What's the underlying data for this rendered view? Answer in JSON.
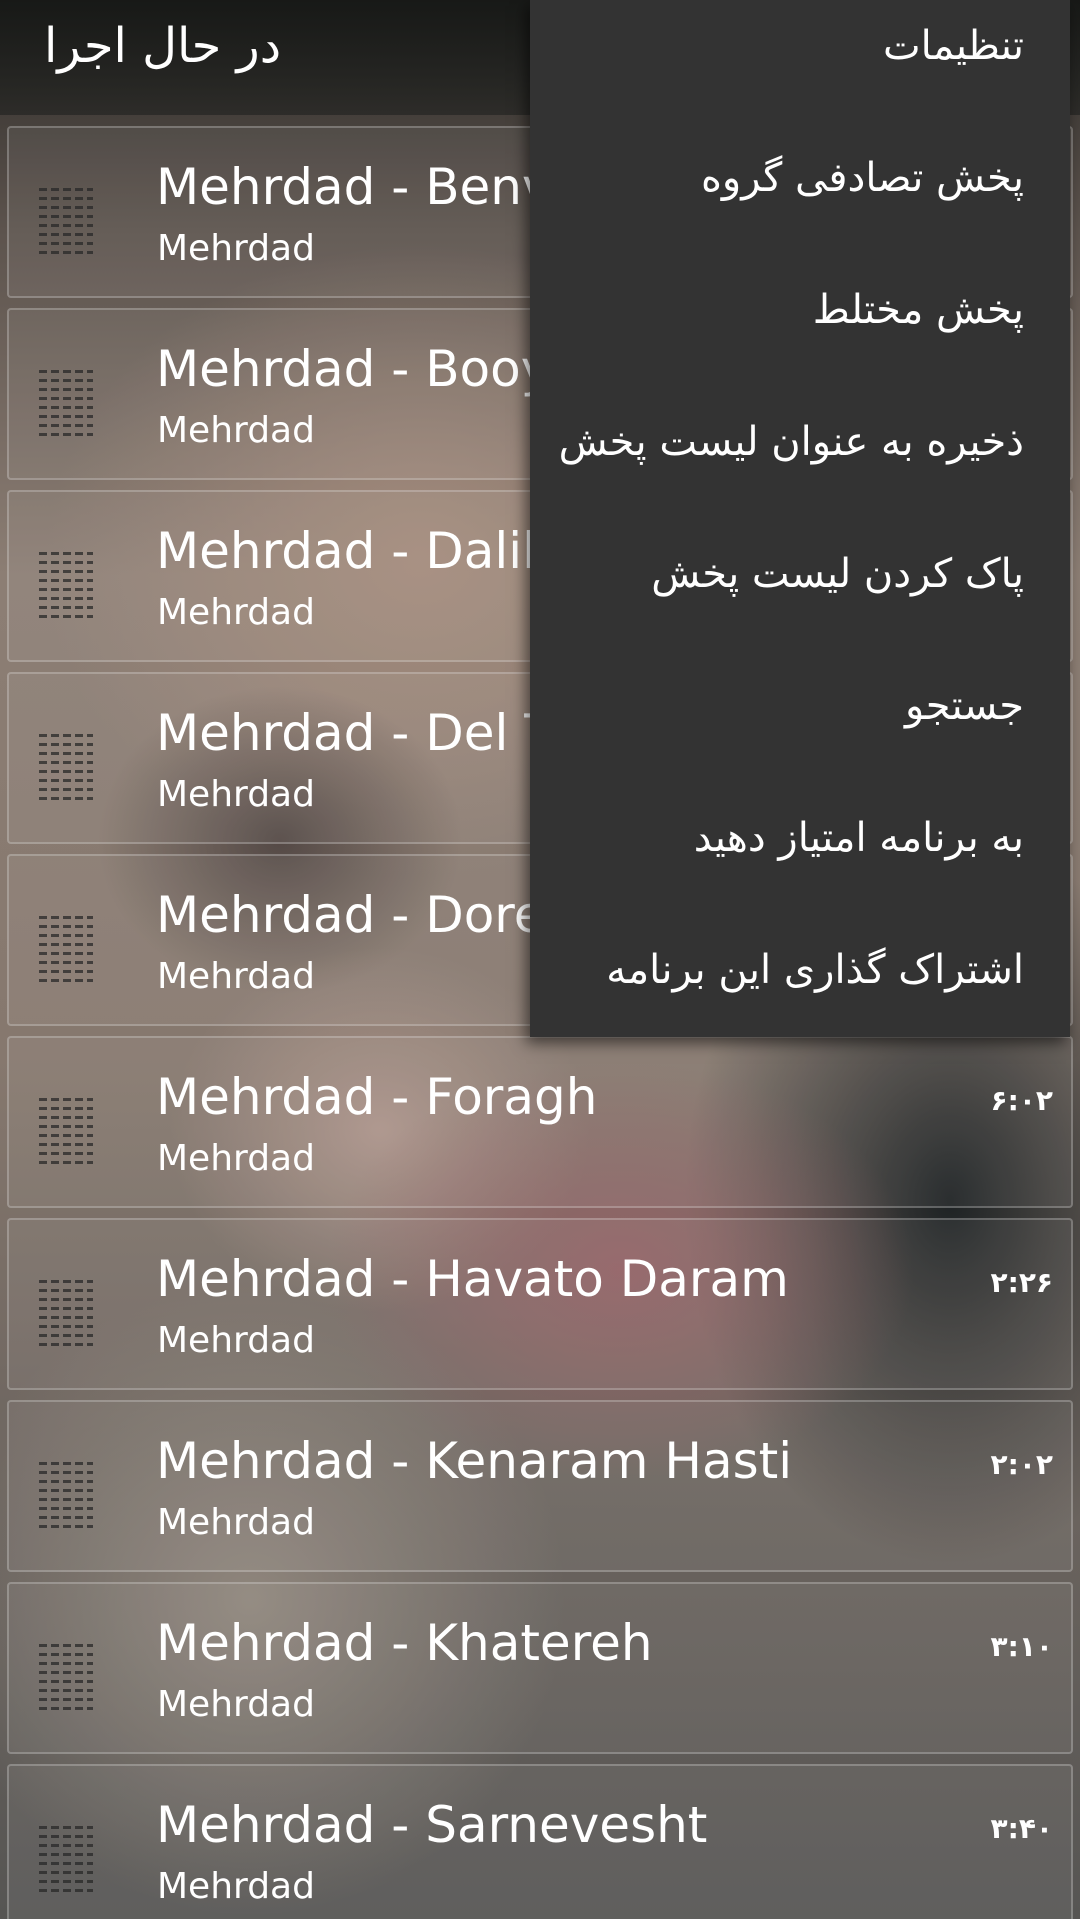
{
  "header": {
    "title": "در حال اجرا"
  },
  "playlist": [
    {
      "title": "Mehrdad - Benvisam",
      "artist": "Mehrdad",
      "duration": ""
    },
    {
      "title": "Mehrdad - Booye",
      "artist": "Mehrdad",
      "duration": ""
    },
    {
      "title": "Mehrdad - Dalile",
      "artist": "Mehrdad",
      "duration": ""
    },
    {
      "title": "Mehrdad - Del To",
      "artist": "Mehrdad",
      "duration": ""
    },
    {
      "title": "Mehrdad - Doret",
      "artist": "Mehrdad",
      "duration": ""
    },
    {
      "title": "Mehrdad - Foragh",
      "artist": "Mehrdad",
      "duration": "۶:۰۲"
    },
    {
      "title": "Mehrdad - Havato Daram",
      "artist": "Mehrdad",
      "duration": "۲:۲۶"
    },
    {
      "title": "Mehrdad - Kenaram Hasti",
      "artist": "Mehrdad",
      "duration": "۲:۰۲"
    },
    {
      "title": "Mehrdad - Khatereh",
      "artist": "Mehrdad",
      "duration": "۳:۱۰"
    },
    {
      "title": "Mehrdad - Sarnevesht",
      "artist": "Mehrdad",
      "duration": "۳:۴۰"
    }
  ],
  "overflow_menu": {
    "items": [
      {
        "label": "تنظیمات"
      },
      {
        "label": "پخش تصادفی گروه"
      },
      {
        "label": "پخش مختلط"
      },
      {
        "label": "ذخیره به عنوان لیست پخش"
      },
      {
        "label": "پاک کردن لیست پخش"
      },
      {
        "label": "جستجو"
      },
      {
        "label": "به برنامه امتیاز دهید"
      },
      {
        "label": "اشتراک گذاری این برنامه"
      }
    ]
  }
}
